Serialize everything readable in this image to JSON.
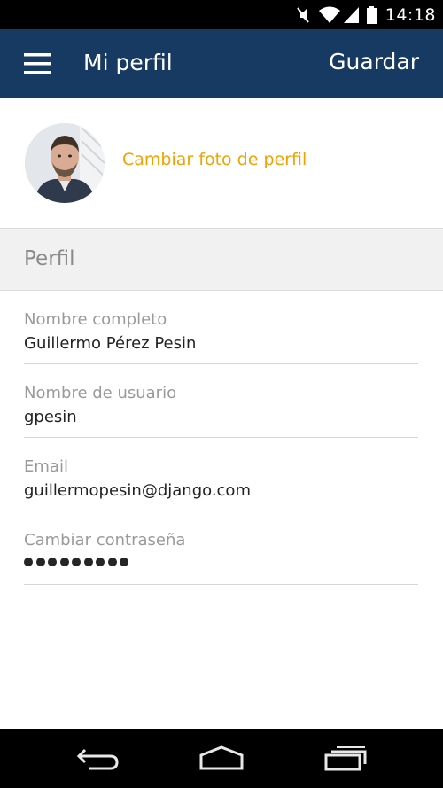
{
  "status_bar": {
    "time": "14:18",
    "icons": [
      "mute-icon",
      "wifi-icon",
      "signal-icon",
      "battery-icon"
    ]
  },
  "app_bar": {
    "menu_icon": "hamburger-menu-icon",
    "title": "Mi perfil",
    "save_label": "Guardar",
    "background": "#173a63"
  },
  "profile_photo": {
    "change_label": "Cambiar foto de perfil",
    "accent_color": "#f2a100"
  },
  "section": {
    "title": "Perfil"
  },
  "fields": [
    {
      "label": "Nombre completo",
      "value": "Guillermo Pérez Pesin"
    },
    {
      "label": "Nombre de usuario",
      "value": "gpesin"
    },
    {
      "label": "Email",
      "value": "guillermopesin@django.com"
    },
    {
      "label": "Cambiar contraseña",
      "value": "•••••••••"
    }
  ],
  "nav_bar": {
    "icons": [
      "back-icon",
      "home-icon",
      "recent-apps-icon"
    ]
  }
}
